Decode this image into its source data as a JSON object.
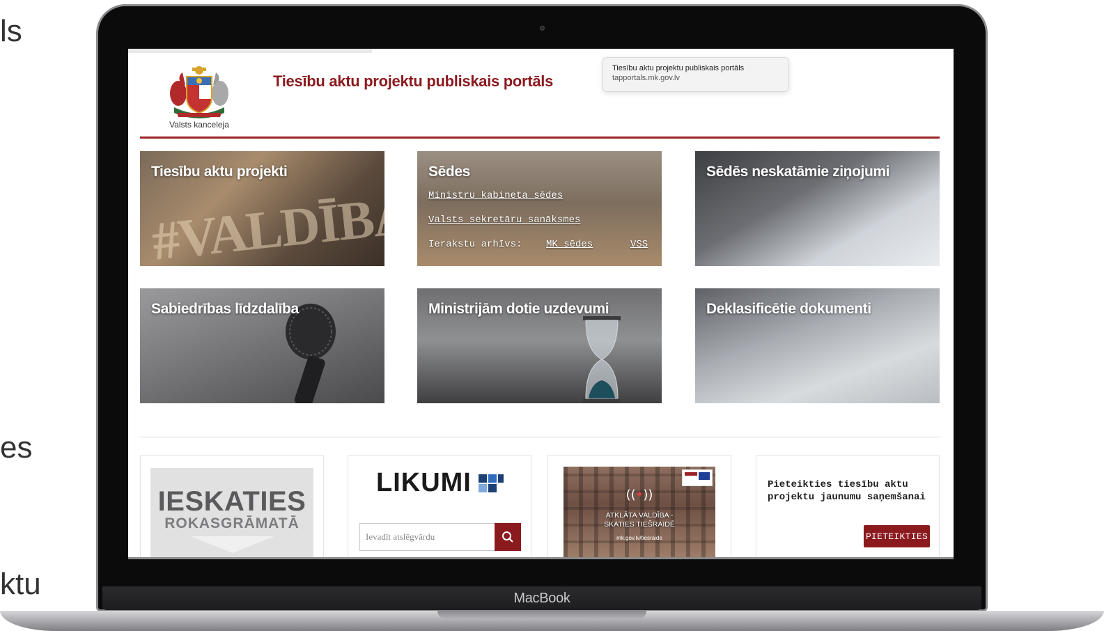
{
  "slide_fragments": [
    "ls",
    "es",
    "ktu"
  ],
  "laptop": {
    "label": "MacBook"
  },
  "tooltip": {
    "title": "Tiesību aktu projektu publiskais portāls",
    "url": "tapportals.mk.gov.lv"
  },
  "header": {
    "agency": "Valsts kanceleja",
    "title": "Tiesību aktu projektu publiskais portāls"
  },
  "tiles": [
    {
      "title": "Tiesību aktu projekti",
      "image_text": "#VALDĪBASMĀJA"
    },
    {
      "title": "Sēdes",
      "links": [
        "Ministru kabineta sēdes",
        "Valsts sekretāru sanāksmes"
      ],
      "archive_label": "Ierakstu arhīvs:",
      "archive_links": [
        "MK sēdes",
        "VSS"
      ]
    },
    {
      "title": "Sēdēs neskatāmie ziņojumi"
    },
    {
      "title": "Sabiedrības līdzdalība"
    },
    {
      "title": "Ministrijām dotie uzdevumi"
    },
    {
      "title": "Deklasificētie dokumenti"
    }
  ],
  "cards": {
    "handbook": {
      "line1": "IESKATIES",
      "line2": "ROKASGRĀMATĀ"
    },
    "likumi": {
      "logo": "LIKUMI",
      "search_placeholder": "Ievadīt atslēgvārdu"
    },
    "live": {
      "line1": "ATKLĀTA VALDĪBA -",
      "line2": "SKATIES TIEŠRAIDĒ",
      "url": "mk.gov.lv/tiesraide"
    },
    "subscribe": {
      "text": "Pieteikties tiesību aktu projektu jaunumu saņemšanai",
      "button": "PIETEIKTIES"
    }
  },
  "colors": {
    "brand": "#8b1a1f",
    "rule": "#9b2226"
  }
}
